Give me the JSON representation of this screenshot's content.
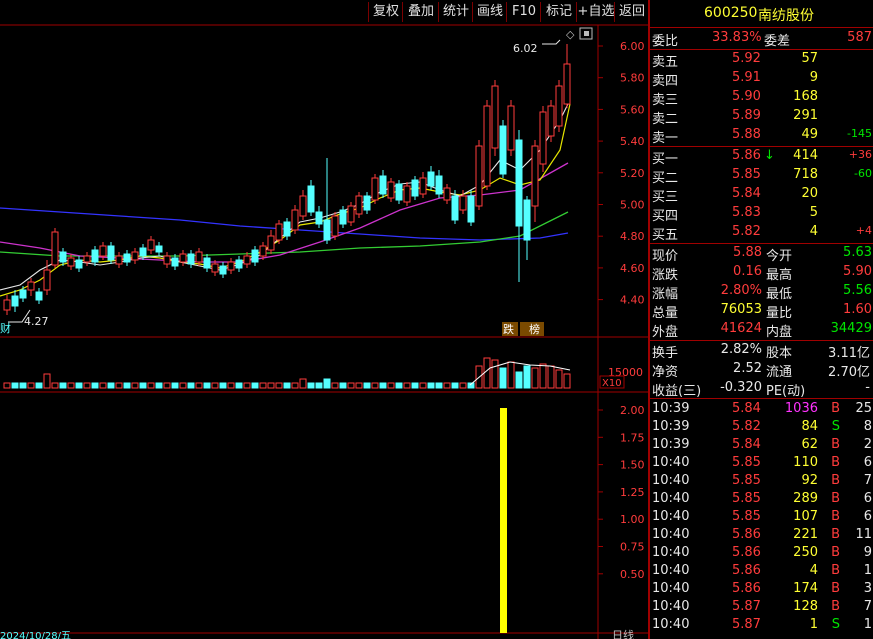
{
  "toolbar": [
    "复权",
    "叠加",
    "统计",
    "画线",
    "F10",
    "标记",
    "+自选",
    "返回"
  ],
  "stock": {
    "code": "600250",
    "name": "南纺股份"
  },
  "price_chart": {
    "y_ticks": [
      "6.00",
      "5.80",
      "5.60",
      "5.40",
      "5.20",
      "5.00",
      "4.80",
      "4.60",
      "4.40"
    ],
    "high_marker": "6.02",
    "low_marker": "4.27",
    "left_tag": "财",
    "tag_fall": "跌",
    "tag_list": "榜"
  },
  "volume_chart": {
    "y_ticks": [
      "15000"
    ],
    "unit": "X10"
  },
  "indicator_chart": {
    "y_ticks": [
      "2.00",
      "1.75",
      "1.50",
      "1.25",
      "1.00",
      "0.75",
      "0.50"
    ]
  },
  "bottom": {
    "date_partial": "2024/10/28/五",
    "date_right": "日线"
  },
  "weibi": {
    "label1": "委比",
    "value1": "33.83%",
    "label2": "委差",
    "value2": "587"
  },
  "asks": [
    {
      "label": "卖五",
      "price": "5.92",
      "vol": "57",
      "chg": ""
    },
    {
      "label": "卖四",
      "price": "5.91",
      "vol": "9",
      "chg": ""
    },
    {
      "label": "卖三",
      "price": "5.90",
      "vol": "168",
      "chg": ""
    },
    {
      "label": "卖二",
      "price": "5.89",
      "vol": "291",
      "chg": ""
    },
    {
      "label": "卖一",
      "price": "5.88",
      "vol": "49",
      "chg": "-145"
    }
  ],
  "bids": [
    {
      "label": "买一",
      "price": "5.86",
      "vol": "414",
      "chg": "+36",
      "arrow": "↓"
    },
    {
      "label": "买二",
      "price": "5.85",
      "vol": "718",
      "chg": "-60",
      "arrow": ""
    },
    {
      "label": "买三",
      "price": "5.84",
      "vol": "20",
      "chg": "",
      "arrow": ""
    },
    {
      "label": "买四",
      "price": "5.83",
      "vol": "5",
      "chg": "",
      "arrow": ""
    },
    {
      "label": "买五",
      "price": "5.82",
      "vol": "4",
      "chg": "+4",
      "arrow": ""
    }
  ],
  "quote": [
    {
      "l1": "现价",
      "v1": "5.88",
      "l2": "今开",
      "v2": "5.63"
    },
    {
      "l1": "涨跌",
      "v1": "0.16",
      "l2": "最高",
      "v2": "5.90"
    },
    {
      "l1": "涨幅",
      "v1": "2.80%",
      "l2": "最低",
      "v2": "5.56"
    },
    {
      "l1": "总量",
      "v1": "76053",
      "l2": "量比",
      "v2": "1.60"
    },
    {
      "l1": "外盘",
      "v1": "41624",
      "l2": "内盘",
      "v2": "34429"
    }
  ],
  "fundamentals": [
    {
      "l1": "换手",
      "v1": "2.82%",
      "l2": "股本",
      "v2": "3.11亿"
    },
    {
      "l1": "净资",
      "v1": "2.52",
      "l2": "流通",
      "v2": "2.70亿"
    },
    {
      "l1": "收益(三)",
      "v1": "-0.320",
      "l2": "PE(动)",
      "v2": "-"
    }
  ],
  "ticks": [
    {
      "time": "10:39",
      "price": "5.84",
      "vol": "1036",
      "side": "B",
      "n": "25"
    },
    {
      "time": "10:39",
      "price": "5.82",
      "vol": "84",
      "side": "S",
      "n": "8"
    },
    {
      "time": "10:39",
      "price": "5.84",
      "vol": "62",
      "side": "B",
      "n": "2"
    },
    {
      "time": "10:40",
      "price": "5.85",
      "vol": "110",
      "side": "B",
      "n": "6"
    },
    {
      "time": "10:40",
      "price": "5.85",
      "vol": "92",
      "side": "B",
      "n": "7"
    },
    {
      "time": "10:40",
      "price": "5.85",
      "vol": "289",
      "side": "B",
      "n": "6"
    },
    {
      "time": "10:40",
      "price": "5.85",
      "vol": "107",
      "side": "B",
      "n": "6"
    },
    {
      "time": "10:40",
      "price": "5.86",
      "vol": "221",
      "side": "B",
      "n": "11"
    },
    {
      "time": "10:40",
      "price": "5.86",
      "vol": "250",
      "side": "B",
      "n": "9"
    },
    {
      "time": "10:40",
      "price": "5.86",
      "vol": "4",
      "side": "B",
      "n": "1"
    },
    {
      "time": "10:40",
      "price": "5.86",
      "vol": "174",
      "side": "B",
      "n": "3"
    },
    {
      "time": "10:40",
      "price": "5.87",
      "vol": "128",
      "side": "B",
      "n": "7"
    },
    {
      "time": "10:40",
      "price": "5.87",
      "vol": "1",
      "side": "S",
      "n": "1"
    }
  ],
  "colors": {
    "up": "#ff3c3c",
    "down": "#55ffff",
    "frame": "#a00000",
    "signal": "#ffff00"
  }
}
